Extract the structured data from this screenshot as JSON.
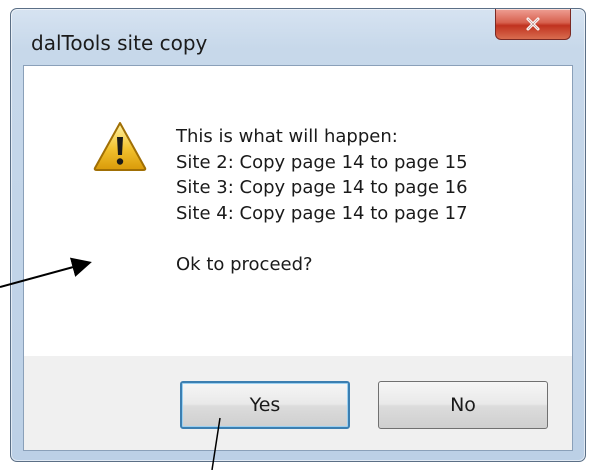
{
  "window": {
    "title": "dalTools site copy"
  },
  "message": {
    "lines": [
      "This is what will happen:",
      "Site 2: Copy page 14 to page 15",
      "Site 3: Copy page 14 to page 16",
      "Site 4: Copy page 14 to page 17"
    ],
    "prompt": "Ok to proceed?"
  },
  "buttons": {
    "yes_label": "Yes",
    "no_label": "No"
  },
  "icons": {
    "warning": "warning-icon",
    "close": "close-icon"
  },
  "colors": {
    "close_button": "#c0321f",
    "warning_fill": "#f2c12e",
    "default_button_border": "#3c7fb1"
  }
}
